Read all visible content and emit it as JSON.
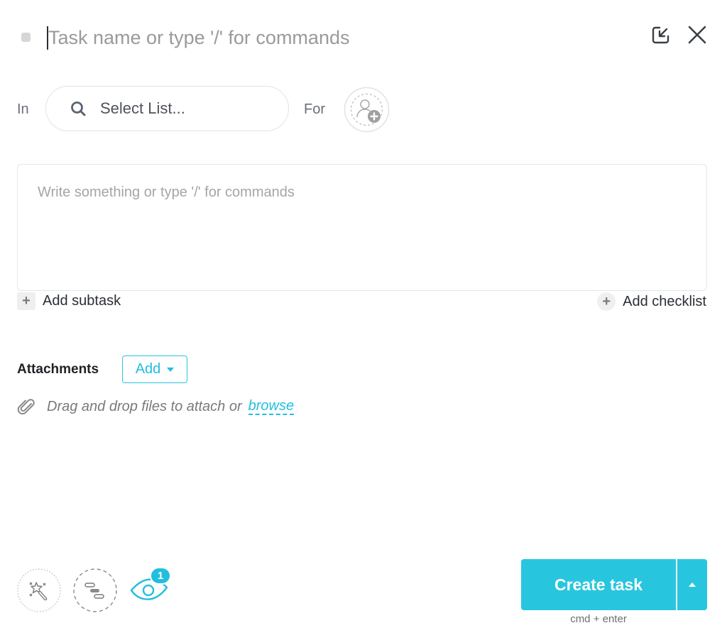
{
  "header": {
    "task_name_value": "",
    "task_name_placeholder": "Task name or type '/' for commands",
    "icons": {
      "status": "status-square-icon",
      "minimize": "minimize-to-corner-icon",
      "close": "close-icon"
    }
  },
  "location": {
    "in_label": "In",
    "list_select_label": "Select List...",
    "list_select_icon": "search-icon",
    "for_label": "For",
    "assignee_icon": "add-assignee-icon"
  },
  "description": {
    "value": "",
    "placeholder": "Write something or type '/' for commands"
  },
  "subtask": {
    "label": "Add subtask",
    "icon": "plus-icon"
  },
  "checklist": {
    "label": "Add checklist",
    "icon": "plus-icon"
  },
  "attachments": {
    "label": "Attachments",
    "add_button": "Add",
    "drop_text": "Drag and drop files to attach or",
    "browse_link": "browse",
    "icon": "paperclip-icon"
  },
  "footer": {
    "tools": [
      {
        "name": "magic-wand",
        "icon": "magic-wand-icon"
      },
      {
        "name": "gantt",
        "icon": "gantt-icon"
      },
      {
        "name": "watchers",
        "icon": "eye-icon",
        "badge": "1"
      }
    ],
    "create_button": "Create task",
    "shortcut_hint": "cmd + enter"
  },
  "colors": {
    "accent": "#28c6de",
    "text": "#2a2e34",
    "muted": "#9a9a9a"
  }
}
